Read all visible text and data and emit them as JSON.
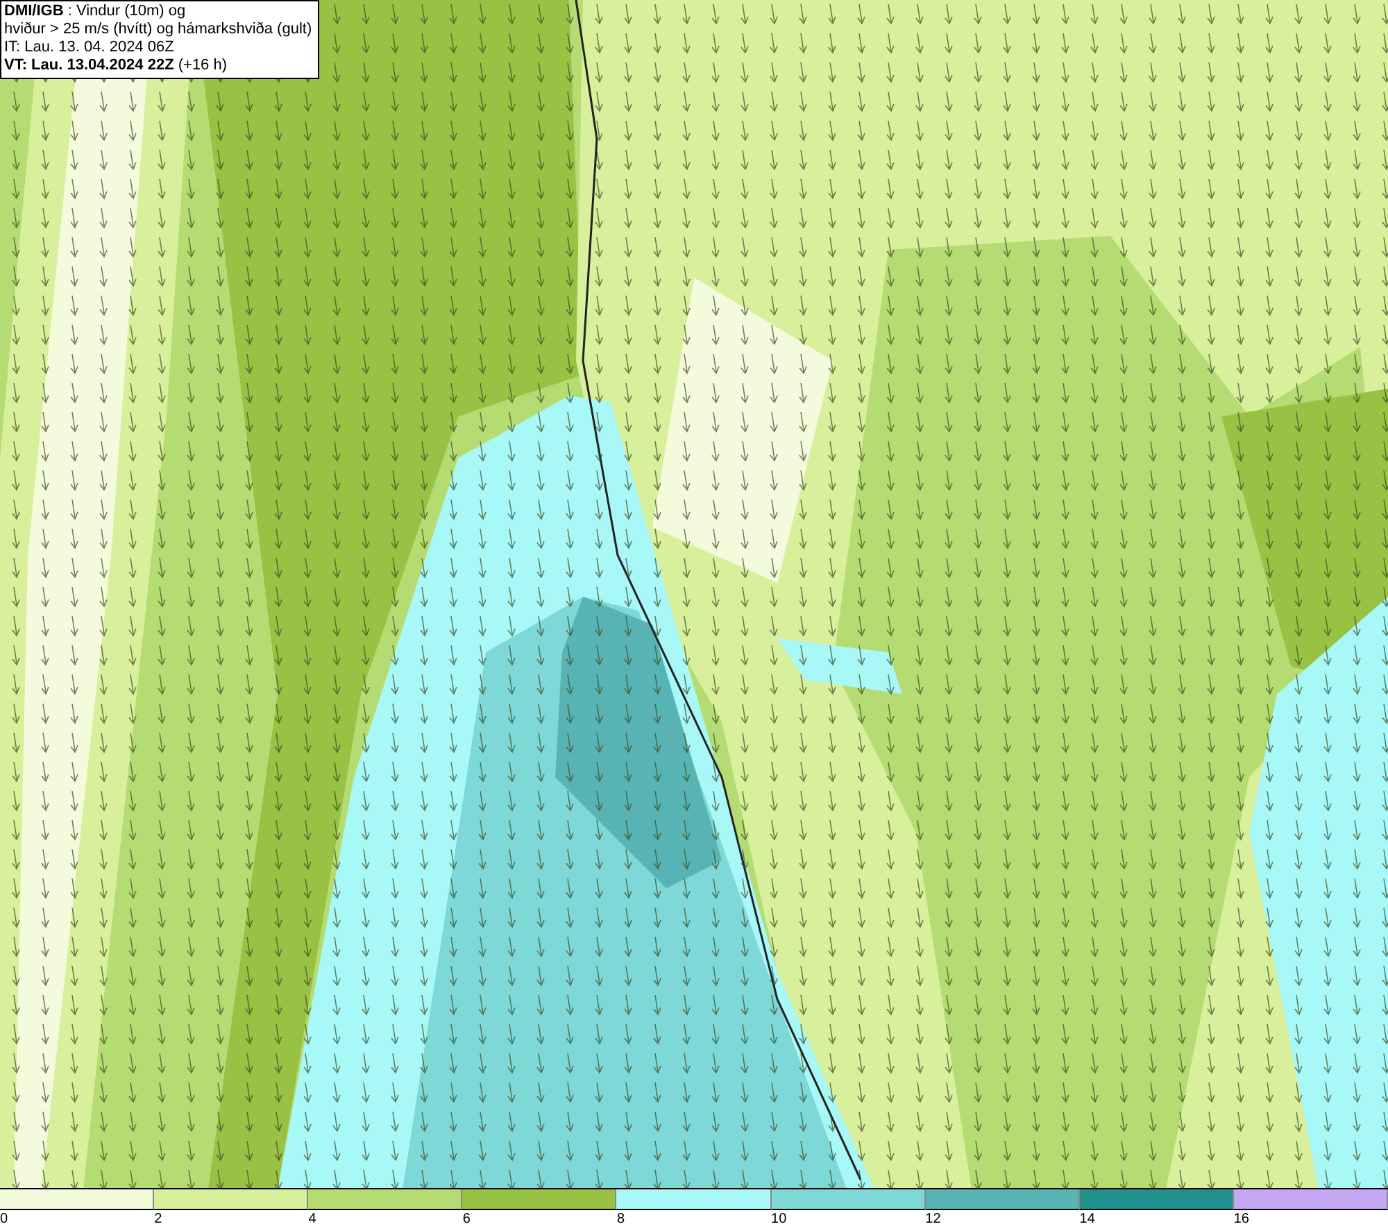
{
  "header": {
    "lines": [
      "**DMI/IGB** : Vindur (10m) og",
      "hviður > 25 m/s (hvítt) og hámarkshviða (gult)",
      "IT: Lau. 13. 04. 2024 06Z",
      "**VT: Lau. 13.04.2024 22Z** (+16 h)"
    ]
  },
  "legend": {
    "bins": [
      {
        "label": "0",
        "color": "#f4fadc"
      },
      {
        "label": "2",
        "color": "#d8ef9c"
      },
      {
        "label": "4",
        "color": "#b5dc72"
      },
      {
        "label": "6",
        "color": "#98c244"
      },
      {
        "label": "8",
        "color": "#a8f8f8"
      },
      {
        "label": "10",
        "color": "#7ed8d8"
      },
      {
        "label": "12",
        "color": "#58b4b4"
      },
      {
        "label": "14",
        "color": "#22908c"
      },
      {
        "label": "16",
        "color": "#c4a8f4"
      }
    ]
  }
}
